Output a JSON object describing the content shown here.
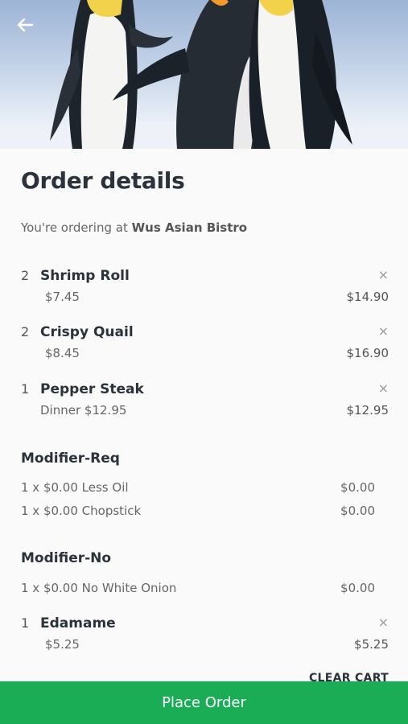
{
  "header": {
    "back_icon": "arrow-left-icon",
    "image": "penguins-photo"
  },
  "page": {
    "title": "Order details",
    "ordering_prefix": "You're ordering at",
    "restaurant": "Wus Asian Bistro"
  },
  "items": [
    {
      "qty": "2",
      "name": "Shrimp Roll",
      "unit_price": "$7.45",
      "total": "$14.90",
      "remove": "×"
    },
    {
      "qty": "2",
      "name": "Crispy Quail",
      "unit_price": "$8.45",
      "total": "$16.90",
      "remove": "×"
    },
    {
      "qty": "1",
      "name": "Pepper Steak",
      "variant": "Dinner",
      "unit_price": "$12.95",
      "total": "$12.95",
      "remove": "×"
    },
    {
      "qty": "1",
      "name": "Edamame",
      "unit_price": "$5.25",
      "total": "$5.25",
      "remove": "×"
    }
  ],
  "modifiers": [
    {
      "title": "Modifier-Req",
      "lines": [
        {
          "desc": "1 x $0.00 Less Oil",
          "price": "$0.00"
        },
        {
          "desc": "1 x $0.00 Chopstick",
          "price": "$0.00"
        }
      ]
    },
    {
      "title": "Modifier-No",
      "lines": [
        {
          "desc": "1 x $0.00 No White Onion",
          "price": "$0.00"
        }
      ]
    }
  ],
  "actions": {
    "clear_cart": "CLEAR CART",
    "place_order": "Place Order"
  },
  "colors": {
    "accent": "#1aad56",
    "text": "#2b323c"
  }
}
